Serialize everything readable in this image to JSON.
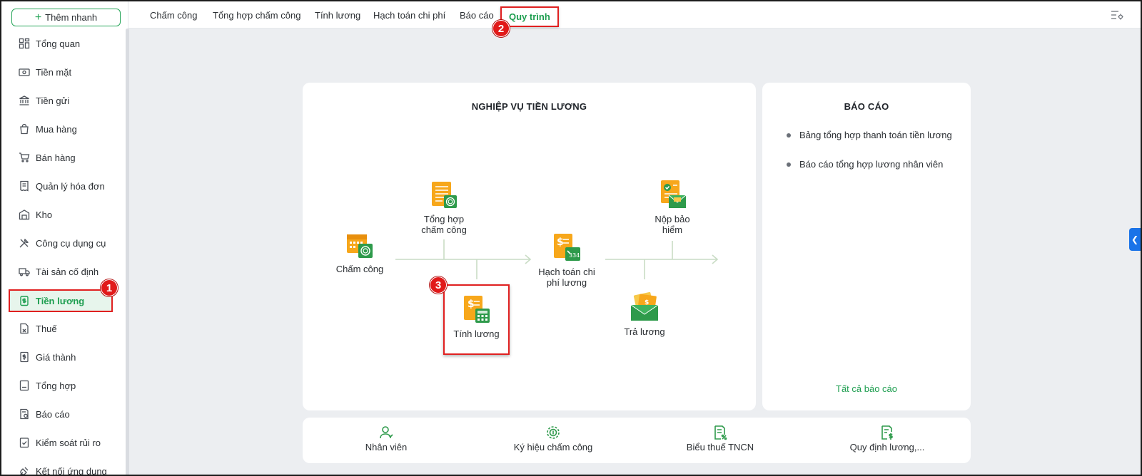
{
  "sidebar": {
    "quick_add_label": "Thêm nhanh",
    "items": [
      {
        "label": "Tổng quan",
        "icon": "dashboard-icon"
      },
      {
        "label": "Tiền mặt",
        "icon": "cash-icon"
      },
      {
        "label": "Tiền gửi",
        "icon": "bank-icon"
      },
      {
        "label": "Mua hàng",
        "icon": "shopping-bag-icon"
      },
      {
        "label": "Bán hàng",
        "icon": "cart-icon"
      },
      {
        "label": "Quản lý hóa đơn",
        "icon": "invoice-icon"
      },
      {
        "label": "Kho",
        "icon": "warehouse-icon"
      },
      {
        "label": "Công cụ dụng cụ",
        "icon": "tools-icon"
      },
      {
        "label": "Tài sản cố định",
        "icon": "truck-icon"
      },
      {
        "label": "Tiền lương",
        "icon": "payroll-icon",
        "active": true
      },
      {
        "label": "Thuế",
        "icon": "tax-icon"
      },
      {
        "label": "Giá thành",
        "icon": "cost-icon"
      },
      {
        "label": "Tổng hợp",
        "icon": "summary-icon"
      },
      {
        "label": "Báo cáo",
        "icon": "report-icon"
      },
      {
        "label": "Kiểm soát rủi ro",
        "icon": "risk-icon"
      },
      {
        "label": "Kết nối ứng dụng",
        "icon": "plug-icon"
      }
    ]
  },
  "topbar": {
    "tabs": [
      {
        "label": "Chấm công"
      },
      {
        "label": "Tổng hợp chấm công"
      },
      {
        "label": "Tính lương"
      },
      {
        "label": "Hạch toán chi phí"
      },
      {
        "label": "Báo cáo"
      },
      {
        "label": "Quy trình",
        "active": true
      }
    ]
  },
  "badges": [
    "1",
    "2",
    "3"
  ],
  "workflow": {
    "title": "NGHIỆP VỤ TIỀN LƯƠNG",
    "nodes": {
      "cham_cong": "Chấm công",
      "tong_hop_line1": "Tổng hợp",
      "tong_hop_line2": "chấm công",
      "tinh_luong": "Tính lương",
      "hach_toan_line1": "Hạch toán chi",
      "hach_toan_line2": "phí lương",
      "nop_bao_hiem_line1": "Nộp bảo",
      "nop_bao_hiem_line2": "hiểm",
      "tra_luong": "Trả lương"
    }
  },
  "reports": {
    "title": "BÁO CÁO",
    "items": [
      "Bảng tổng hợp thanh toán tiền lương",
      "Báo cáo tổng hợp lương nhân viên"
    ],
    "all_label": "Tất cả báo cáo"
  },
  "bottom_links": [
    {
      "label": "Nhân viên",
      "icon": "employee-icon"
    },
    {
      "label": "Ký hiệu chấm công",
      "icon": "fingerprint-icon"
    },
    {
      "label": "Biểu thuế TNCN",
      "icon": "tax-table-icon"
    },
    {
      "label": "Quy định lương,...",
      "icon": "salary-rule-icon"
    }
  ],
  "colors": {
    "accent": "#1e9e50",
    "highlight": "#e02020",
    "badge": "#e11a1a",
    "collapse_tab": "#1a73e8"
  }
}
